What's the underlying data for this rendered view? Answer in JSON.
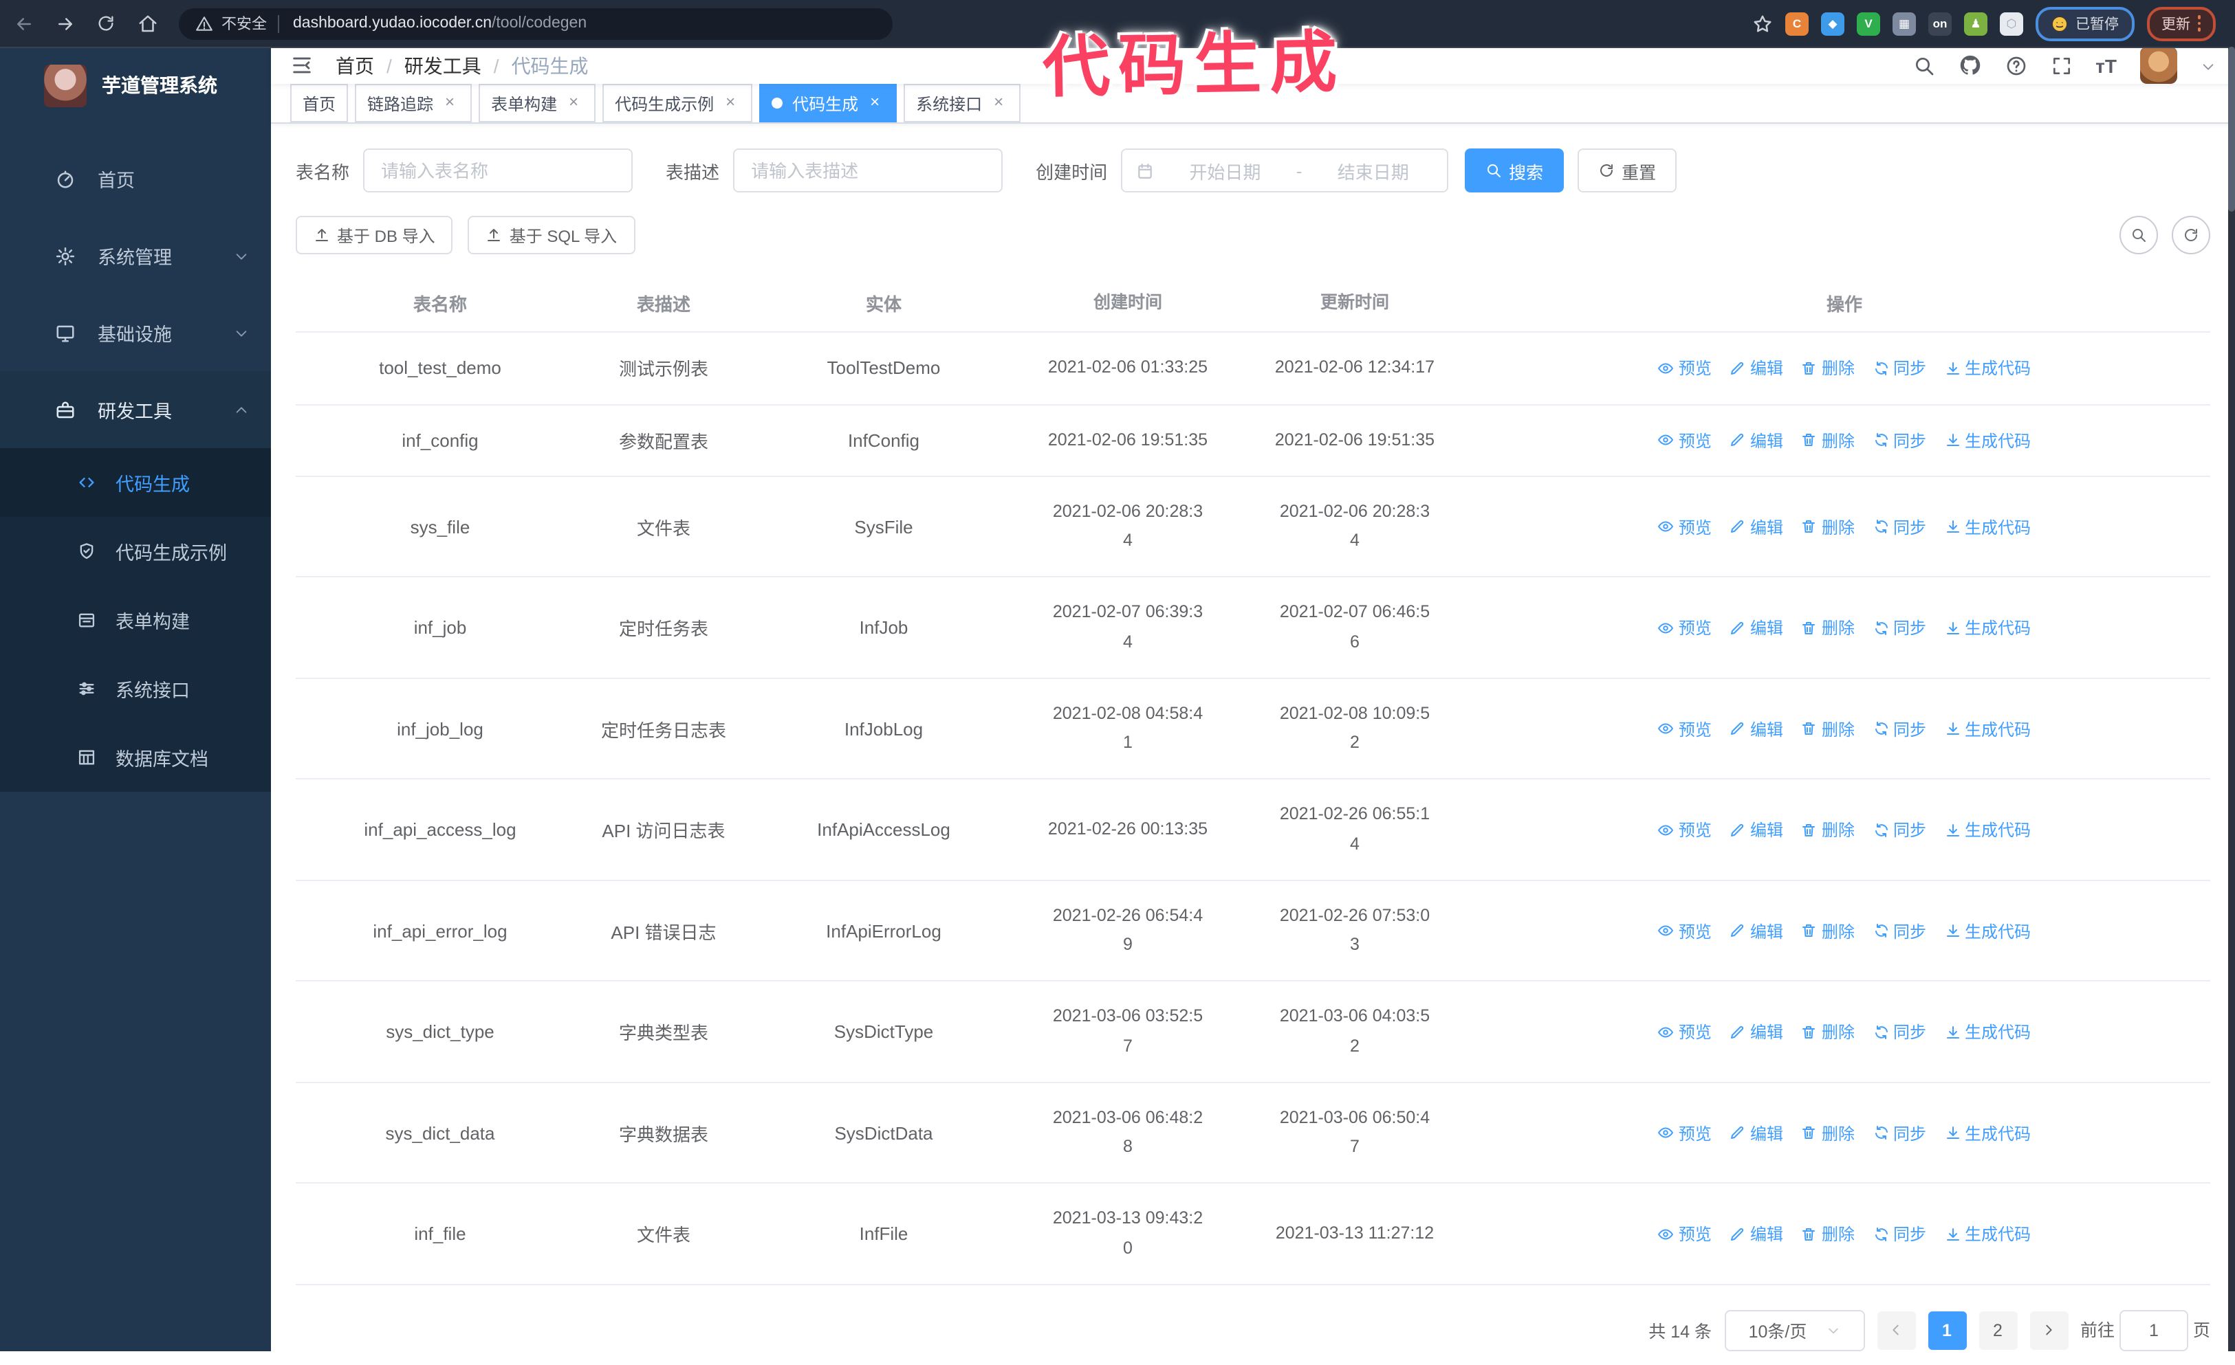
{
  "colors": {
    "accent": "#409EFF",
    "annotation": "#fb4161",
    "sidebar_bg": "#20374f",
    "submenu_bg": "#16293d",
    "chrome_bg": "#232c3a"
  },
  "browser": {
    "security_label": "不安全",
    "url_domain": "dashboard.yudao.iocoder.cn",
    "url_path": "/tool/codegen",
    "paused_badge": "已暂停",
    "update_badge": "更新",
    "extensions": [
      {
        "name": "orange-extension-icon",
        "bg": "#e8833a",
        "glyph": "C"
      },
      {
        "name": "gem-extension-icon",
        "bg": "#3d9be9",
        "glyph": "◆"
      },
      {
        "name": "green-check-extension-icon",
        "bg": "#2fae4e",
        "glyph": "V"
      },
      {
        "name": "grid-extension-icon",
        "bg": "#7d8aa0",
        "glyph": "▦"
      },
      {
        "name": "on-badge-extension-icon",
        "bg": "#3a4452",
        "glyph": "on"
      },
      {
        "name": "person-extension-icon",
        "bg": "#7bb241",
        "glyph": "♟"
      },
      {
        "name": "puzzle-extension-icon",
        "bg": "#e7ebf0",
        "glyph": "⬡"
      }
    ]
  },
  "annotation": {
    "text": "代码生成"
  },
  "sidebar": {
    "logo_title": "芋道管理系统",
    "items": [
      {
        "key": "home",
        "label": "首页",
        "icon": "dashboard-icon",
        "chevron": null,
        "open": false
      },
      {
        "key": "system",
        "label": "系统管理",
        "icon": "gear-icon",
        "chevron": "down",
        "open": false
      },
      {
        "key": "infra",
        "label": "基础设施",
        "icon": "monitor-icon",
        "chevron": "down",
        "open": false
      },
      {
        "key": "devtools",
        "label": "研发工具",
        "icon": "briefcase-icon",
        "chevron": "up",
        "open": true
      }
    ],
    "submenu": [
      {
        "key": "codegen",
        "label": "代码生成",
        "icon": "code-icon",
        "active": true
      },
      {
        "key": "codegen-example",
        "label": "代码生成示例",
        "icon": "shield-check-icon",
        "active": false
      },
      {
        "key": "form-builder",
        "label": "表单构建",
        "icon": "form-icon",
        "active": false
      },
      {
        "key": "api",
        "label": "系统接口",
        "icon": "sliders-icon",
        "active": false
      },
      {
        "key": "db-doc",
        "label": "数据库文档",
        "icon": "database-icon",
        "active": false
      }
    ]
  },
  "header": {
    "breadcrumb": [
      "首页",
      "研发工具",
      "代码生成"
    ]
  },
  "tabs": [
    {
      "key": "home",
      "label": "首页",
      "closable": false,
      "active": false
    },
    {
      "key": "tracing",
      "label": "链路追踪",
      "closable": true,
      "active": false
    },
    {
      "key": "form-builder",
      "label": "表单构建",
      "closable": true,
      "active": false
    },
    {
      "key": "codegen-example",
      "label": "代码生成示例",
      "closable": true,
      "active": false
    },
    {
      "key": "codegen",
      "label": "代码生成",
      "closable": true,
      "active": true
    },
    {
      "key": "api",
      "label": "系统接口",
      "closable": true,
      "active": false
    }
  ],
  "filters": {
    "name_label": "表名称",
    "name_placeholder": "请输入表名称",
    "desc_label": "表描述",
    "desc_placeholder": "请输入表描述",
    "time_label": "创建时间",
    "start_placeholder": "开始日期",
    "range_separator": "-",
    "end_placeholder": "结束日期",
    "search_label": "搜索",
    "reset_label": "重置"
  },
  "toolbar": {
    "db_import_label": "基于 DB 导入",
    "sql_import_label": "基于 SQL 导入"
  },
  "table": {
    "columns": [
      "表名称",
      "表描述",
      "实体",
      "创建时间",
      "更新时间",
      "操作"
    ],
    "action_labels": [
      "预览",
      "编辑",
      "删除",
      "同步",
      "生成代码"
    ],
    "action_keys": [
      "preview",
      "edit",
      "delete",
      "sync",
      "generate"
    ],
    "action_icons": [
      "eye-icon",
      "pencil-icon",
      "trash-icon",
      "sync-icon",
      "download-icon"
    ],
    "rows": [
      {
        "name": "tool_test_demo",
        "desc": "测试示例表",
        "entity": "ToolTestDemo",
        "created": "2021-02-06 01:33:25",
        "updated": "2021-02-06 12:34:17"
      },
      {
        "name": "inf_config",
        "desc": "参数配置表",
        "entity": "InfConfig",
        "created": "2021-02-06 19:51:35",
        "updated": "2021-02-06 19:51:35"
      },
      {
        "name": "sys_file",
        "desc": "文件表",
        "entity": "SysFile",
        "created": "2021-02-06 20:28:3\n4",
        "updated": "2021-02-06 20:28:3\n4"
      },
      {
        "name": "inf_job",
        "desc": "定时任务表",
        "entity": "InfJob",
        "created": "2021-02-07 06:39:3\n4",
        "updated": "2021-02-07 06:46:5\n6"
      },
      {
        "name": "inf_job_log",
        "desc": "定时任务日志表",
        "entity": "InfJobLog",
        "created": "2021-02-08 04:58:4\n1",
        "updated": "2021-02-08 10:09:5\n2"
      },
      {
        "name": "inf_api_access_log",
        "desc": "API 访问日志表",
        "entity": "InfApiAccessLog",
        "created": "2021-02-26 00:13:35",
        "updated": "2021-02-26 06:55:1\n4"
      },
      {
        "name": "inf_api_error_log",
        "desc": "API 错误日志",
        "entity": "InfApiErrorLog",
        "created": "2021-02-26 06:54:4\n9",
        "updated": "2021-02-26 07:53:0\n3"
      },
      {
        "name": "sys_dict_type",
        "desc": "字典类型表",
        "entity": "SysDictType",
        "created": "2021-03-06 03:52:5\n7",
        "updated": "2021-03-06 04:03:5\n2"
      },
      {
        "name": "sys_dict_data",
        "desc": "字典数据表",
        "entity": "SysDictData",
        "created": "2021-03-06 06:48:2\n8",
        "updated": "2021-03-06 06:50:4\n7"
      },
      {
        "name": "inf_file",
        "desc": "文件表",
        "entity": "InfFile",
        "created": "2021-03-13 09:43:2\n0",
        "updated": "2021-03-13 11:27:12"
      }
    ]
  },
  "pagination": {
    "total": "共 14 条",
    "page_size": "10条/页",
    "pages": [
      "1",
      "2"
    ],
    "active_page": "1",
    "goto_label": "前往",
    "goto_value": "1",
    "goto_suffix": "页"
  }
}
